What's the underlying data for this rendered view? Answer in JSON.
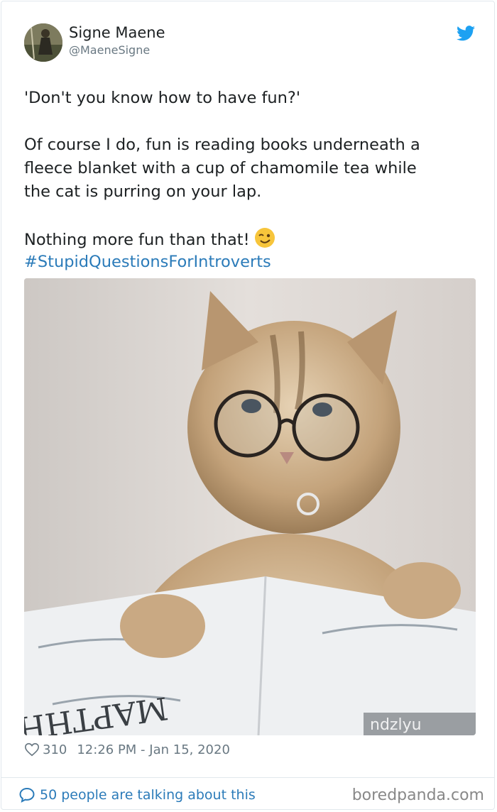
{
  "tweet": {
    "author_name": "Signe Maene",
    "author_handle": "@MaeneSigne",
    "line1": "'Don't you know how to have fun?'",
    "line2": "Of course I do, fun is reading books underneath a",
    "line3": "fleece blanket with a cup of chamomile tea while",
    "line4": "the cat is purring on your lap.",
    "line5": "Nothing more fun than that!",
    "hashtag": "#StupidQuestionsForIntroverts",
    "likes": "310",
    "timestamp": "12:26 PM - Jan 15, 2020",
    "book_title": "MAPTHH",
    "watermark": "ndzlyu"
  },
  "footer": {
    "talking": "50 people are talking about this",
    "brand": "boredpanda.com"
  },
  "colors": {
    "link": "#2b7bb9",
    "muted": "#697882",
    "twitter_blue": "#1da1f2"
  }
}
